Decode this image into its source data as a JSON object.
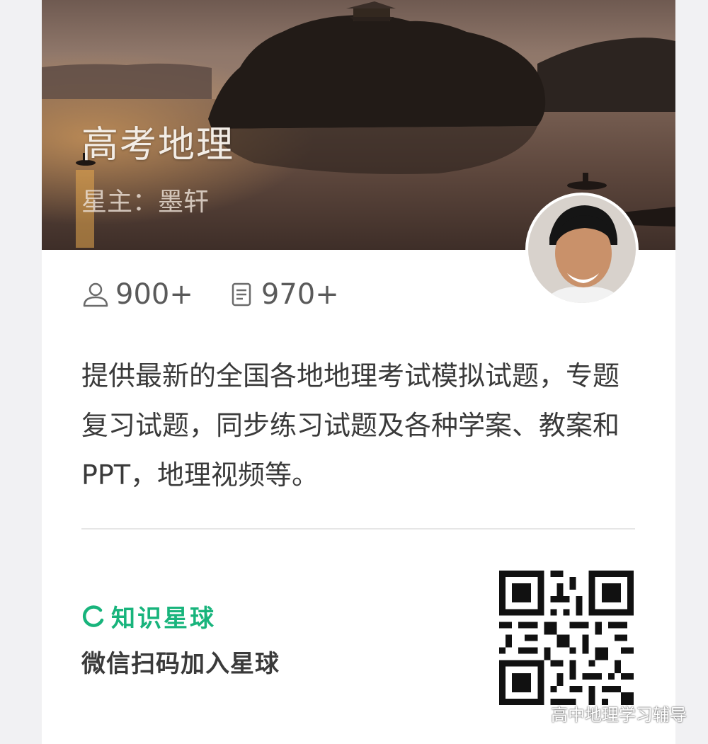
{
  "banner": {
    "title": "高考地理",
    "owner": "星主：墨轩"
  },
  "stats": {
    "members": "900+",
    "posts": "970+"
  },
  "description": "提供最新的全国各地地理考试模拟试题，专题复习试题，同步练习试题及各种学案、教案和PPT，地理视频等。",
  "footer": {
    "brand": "知识星球",
    "join_text": "微信扫码加入星球"
  },
  "watermark": "高中地理学习辅导",
  "colors": {
    "brand_green": "#18b47c",
    "text_main": "#3a3a3a",
    "text_muted": "#5a5a5a"
  },
  "icons": {
    "members": "person-icon",
    "posts": "document-icon",
    "brand": "zsxq-logo-icon",
    "watermark": "wechat-icon"
  }
}
